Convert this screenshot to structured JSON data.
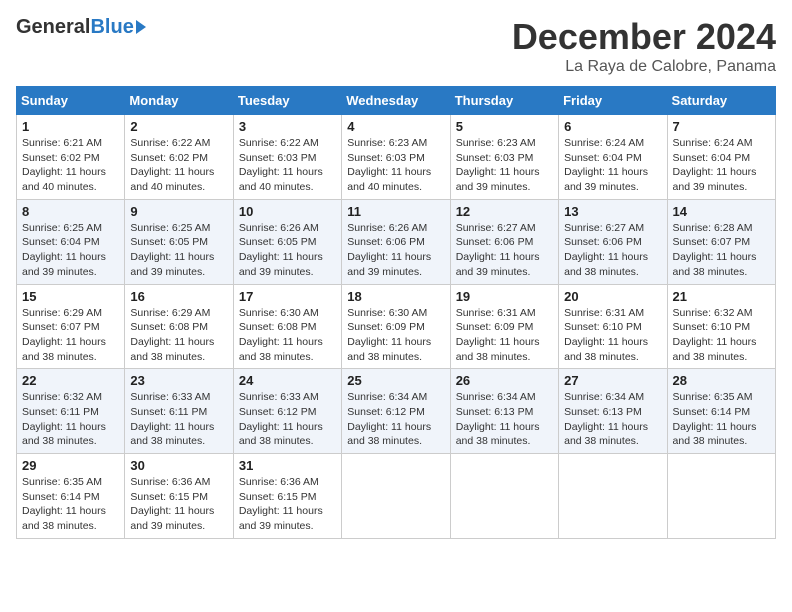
{
  "logo": {
    "general": "General",
    "blue": "Blue"
  },
  "title": {
    "month": "December 2024",
    "location": "La Raya de Calobre, Panama"
  },
  "headers": [
    "Sunday",
    "Monday",
    "Tuesday",
    "Wednesday",
    "Thursday",
    "Friday",
    "Saturday"
  ],
  "weeks": [
    [
      {
        "day": "1",
        "sunrise": "6:21 AM",
        "sunset": "6:02 PM",
        "hours": "11",
        "minutes": "40"
      },
      {
        "day": "2",
        "sunrise": "6:22 AM",
        "sunset": "6:02 PM",
        "hours": "11",
        "minutes": "40"
      },
      {
        "day": "3",
        "sunrise": "6:22 AM",
        "sunset": "6:03 PM",
        "hours": "11",
        "minutes": "40"
      },
      {
        "day": "4",
        "sunrise": "6:23 AM",
        "sunset": "6:03 PM",
        "hours": "11",
        "minutes": "40"
      },
      {
        "day": "5",
        "sunrise": "6:23 AM",
        "sunset": "6:03 PM",
        "hours": "11",
        "minutes": "39"
      },
      {
        "day": "6",
        "sunrise": "6:24 AM",
        "sunset": "6:04 PM",
        "hours": "11",
        "minutes": "39"
      },
      {
        "day": "7",
        "sunrise": "6:24 AM",
        "sunset": "6:04 PM",
        "hours": "11",
        "minutes": "39"
      }
    ],
    [
      {
        "day": "8",
        "sunrise": "6:25 AM",
        "sunset": "6:04 PM",
        "hours": "11",
        "minutes": "39"
      },
      {
        "day": "9",
        "sunrise": "6:25 AM",
        "sunset": "6:05 PM",
        "hours": "11",
        "minutes": "39"
      },
      {
        "day": "10",
        "sunrise": "6:26 AM",
        "sunset": "6:05 PM",
        "hours": "11",
        "minutes": "39"
      },
      {
        "day": "11",
        "sunrise": "6:26 AM",
        "sunset": "6:06 PM",
        "hours": "11",
        "minutes": "39"
      },
      {
        "day": "12",
        "sunrise": "6:27 AM",
        "sunset": "6:06 PM",
        "hours": "11",
        "minutes": "39"
      },
      {
        "day": "13",
        "sunrise": "6:27 AM",
        "sunset": "6:06 PM",
        "hours": "11",
        "minutes": "38"
      },
      {
        "day": "14",
        "sunrise": "6:28 AM",
        "sunset": "6:07 PM",
        "hours": "11",
        "minutes": "38"
      }
    ],
    [
      {
        "day": "15",
        "sunrise": "6:29 AM",
        "sunset": "6:07 PM",
        "hours": "11",
        "minutes": "38"
      },
      {
        "day": "16",
        "sunrise": "6:29 AM",
        "sunset": "6:08 PM",
        "hours": "11",
        "minutes": "38"
      },
      {
        "day": "17",
        "sunrise": "6:30 AM",
        "sunset": "6:08 PM",
        "hours": "11",
        "minutes": "38"
      },
      {
        "day": "18",
        "sunrise": "6:30 AM",
        "sunset": "6:09 PM",
        "hours": "11",
        "minutes": "38"
      },
      {
        "day": "19",
        "sunrise": "6:31 AM",
        "sunset": "6:09 PM",
        "hours": "11",
        "minutes": "38"
      },
      {
        "day": "20",
        "sunrise": "6:31 AM",
        "sunset": "6:10 PM",
        "hours": "11",
        "minutes": "38"
      },
      {
        "day": "21",
        "sunrise": "6:32 AM",
        "sunset": "6:10 PM",
        "hours": "11",
        "minutes": "38"
      }
    ],
    [
      {
        "day": "22",
        "sunrise": "6:32 AM",
        "sunset": "6:11 PM",
        "hours": "11",
        "minutes": "38"
      },
      {
        "day": "23",
        "sunrise": "6:33 AM",
        "sunset": "6:11 PM",
        "hours": "11",
        "minutes": "38"
      },
      {
        "day": "24",
        "sunrise": "6:33 AM",
        "sunset": "6:12 PM",
        "hours": "11",
        "minutes": "38"
      },
      {
        "day": "25",
        "sunrise": "6:34 AM",
        "sunset": "6:12 PM",
        "hours": "11",
        "minutes": "38"
      },
      {
        "day": "26",
        "sunrise": "6:34 AM",
        "sunset": "6:13 PM",
        "hours": "11",
        "minutes": "38"
      },
      {
        "day": "27",
        "sunrise": "6:34 AM",
        "sunset": "6:13 PM",
        "hours": "11",
        "minutes": "38"
      },
      {
        "day": "28",
        "sunrise": "6:35 AM",
        "sunset": "6:14 PM",
        "hours": "11",
        "minutes": "38"
      }
    ],
    [
      {
        "day": "29",
        "sunrise": "6:35 AM",
        "sunset": "6:14 PM",
        "hours": "11",
        "minutes": "38"
      },
      {
        "day": "30",
        "sunrise": "6:36 AM",
        "sunset": "6:15 PM",
        "hours": "11",
        "minutes": "39"
      },
      {
        "day": "31",
        "sunrise": "6:36 AM",
        "sunset": "6:15 PM",
        "hours": "11",
        "minutes": "39"
      },
      null,
      null,
      null,
      null
    ]
  ],
  "labels": {
    "sunrise": "Sunrise:",
    "sunset": "Sunset:",
    "daylight": "Daylight: ",
    "hours_suffix": " hours",
    "and": "and ",
    "minutes_suffix": " minutes."
  }
}
